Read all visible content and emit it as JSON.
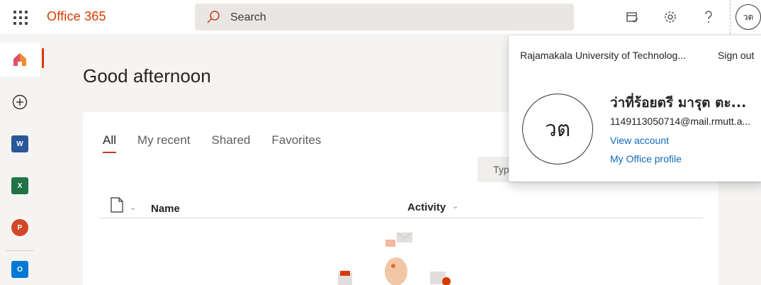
{
  "header": {
    "brand": "Office 365",
    "search_placeholder": "Search",
    "avatar_initials": "วต"
  },
  "greeting": "Good afternoon",
  "tabs": [
    {
      "label": "All",
      "active": true
    },
    {
      "label": "My recent",
      "active": false
    },
    {
      "label": "Shared",
      "active": false
    },
    {
      "label": "Favorites",
      "active": false
    }
  ],
  "filter_placeholder": "Typ",
  "table": {
    "col_name": "Name",
    "col_activity": "Activity"
  },
  "account_popup": {
    "org_name": "Rajamakala University of Technolog...",
    "sign_out": "Sign out",
    "initials": "วต",
    "user_name": "ว่าที่ร้อยตรี มารุต ตะ...",
    "email": "1149113050714@mail.rmutt.a...",
    "view_account": "View account",
    "office_profile": "My Office profile"
  },
  "colors": {
    "brand": "#d83b01",
    "link": "#0f6cbd",
    "tab_underline": "#c43e1c"
  }
}
